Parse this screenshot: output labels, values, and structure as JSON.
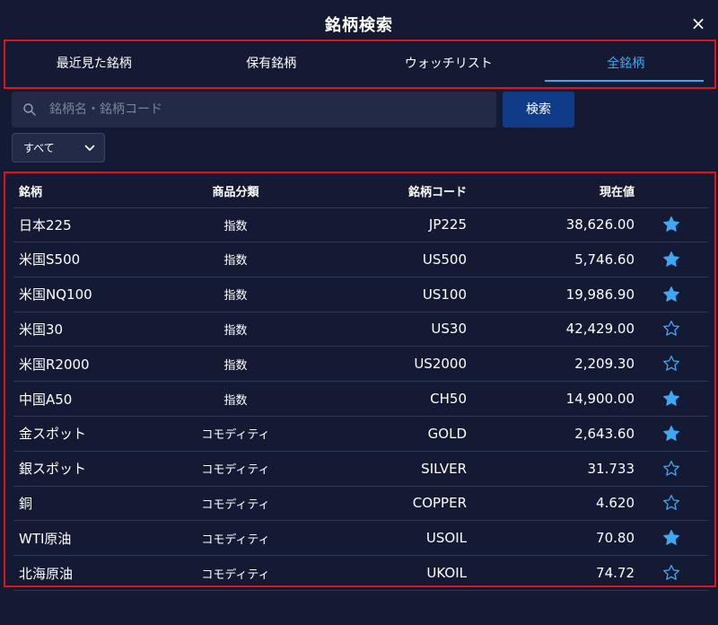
{
  "header": {
    "title": "銘柄検索",
    "close_label": "×"
  },
  "tabs": [
    {
      "label": "最近見た銘柄",
      "active": false
    },
    {
      "label": "保有銘柄",
      "active": false
    },
    {
      "label": "ウォッチリスト",
      "active": false
    },
    {
      "label": "全銘柄",
      "active": true
    }
  ],
  "search": {
    "placeholder": "銘柄名・銘柄コード",
    "value": "",
    "button_label": "検索",
    "icon": "search-icon"
  },
  "filter": {
    "selected": "すべて",
    "icon": "chevron-down-icon"
  },
  "table": {
    "headers": {
      "name": "銘柄",
      "category": "商品分類",
      "code": "銘柄コード",
      "price": "現在値"
    },
    "rows": [
      {
        "name": "日本225",
        "category": "指数",
        "code": "JP225",
        "price": "38,626.00",
        "favorite": true
      },
      {
        "name": "米国S500",
        "category": "指数",
        "code": "US500",
        "price": "5,746.60",
        "favorite": true
      },
      {
        "name": "米国NQ100",
        "category": "指数",
        "code": "US100",
        "price": "19,986.90",
        "favorite": true
      },
      {
        "name": "米国30",
        "category": "指数",
        "code": "US30",
        "price": "42,429.00",
        "favorite": false
      },
      {
        "name": "米国R2000",
        "category": "指数",
        "code": "US2000",
        "price": "2,209.30",
        "favorite": false
      },
      {
        "name": "中国A50",
        "category": "指数",
        "code": "CH50",
        "price": "14,900.00",
        "favorite": true
      },
      {
        "name": "金スポット",
        "category": "コモディティ",
        "code": "GOLD",
        "price": "2,643.60",
        "favorite": true
      },
      {
        "name": "銀スポット",
        "category": "コモディティ",
        "code": "SILVER",
        "price": "31.733",
        "favorite": false
      },
      {
        "name": "銅",
        "category": "コモディティ",
        "code": "COPPER",
        "price": "4.620",
        "favorite": false
      },
      {
        "name": "WTI原油",
        "category": "コモディティ",
        "code": "USOIL",
        "price": "70.80",
        "favorite": true
      },
      {
        "name": "北海原油",
        "category": "コモディティ",
        "code": "UKOIL",
        "price": "74.72",
        "favorite": false
      }
    ]
  },
  "colors": {
    "accent": "#3fa8f4",
    "background": "#141a33",
    "highlight_border": "#e0121f",
    "button": "#0f3b87"
  }
}
